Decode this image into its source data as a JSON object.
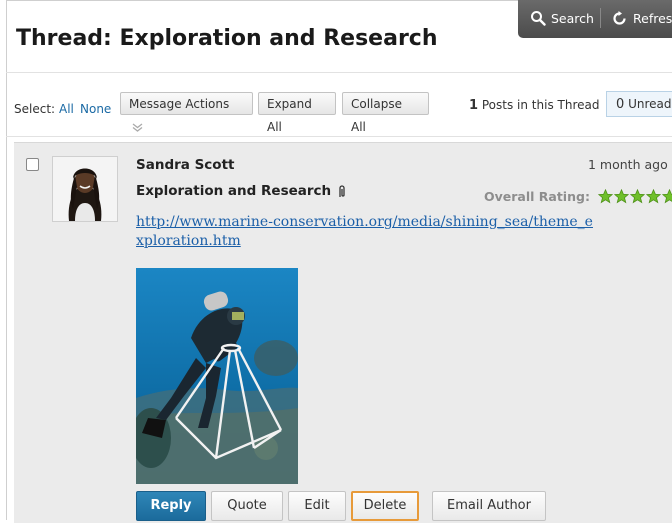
{
  "toolbar": {
    "search_label": "Search",
    "refresh_label": "Refres"
  },
  "page": {
    "title": "Thread: Exploration and Research"
  },
  "selection": {
    "label": "Select:",
    "all": "All",
    "none": "None"
  },
  "actions": {
    "message_actions": "Message Actions",
    "expand_all": "Expand All",
    "collapse_all": "Collapse All"
  },
  "thread_stats": {
    "post_count": "1",
    "posts_label": "Posts in this Thread",
    "unread_count": "0",
    "unread_label": "Unread"
  },
  "post": {
    "author": "Sandra Scott",
    "time": "1 month ago",
    "subject": "Exploration and Research",
    "rating_label": "Overall Rating:",
    "rating_value": 5,
    "rating_max": 5,
    "link": "http://www.marine-conservation.org/media/shining_sea/theme_exploration.htm",
    "buttons": {
      "reply": "Reply",
      "quote": "Quote",
      "edit": "Edit",
      "delete": "Delete",
      "email_author": "Email Author"
    }
  },
  "colors": {
    "accent": "#1b6aa5",
    "star": "#6fbf2a",
    "primary_button": "#1f72a3",
    "focus_ring": "#e79a3a"
  }
}
